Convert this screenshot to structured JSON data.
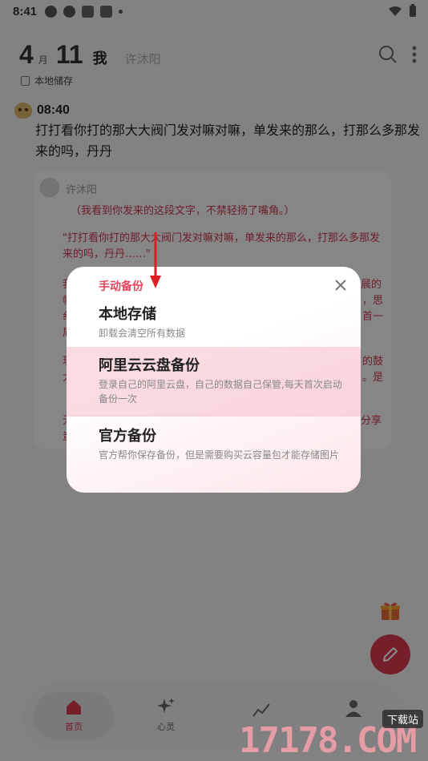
{
  "status_bar": {
    "time": "8:41"
  },
  "header": {
    "day": "4",
    "month_unit": "月",
    "date_num": "11",
    "me": "我",
    "partner": "许沐阳",
    "storage_label": "本地储存"
  },
  "post": {
    "time": "08:40",
    "text": "打打看你打的那大大阀门发对嘛对嘛，单发来的那么，打那么多那发来的吗，丹丹"
  },
  "reply": {
    "name": "许沐阳",
    "action_line": "（我看到你发来的这段文字，不禁轻扬了嘴角。）",
    "quote": "\"打打看你打的那大大阀门发对嘛对嘛，单发来的那么，打那么多那发来的吗，丹丹……\"",
    "edge_left": [
      "我",
      "帆",
      "纟",
      "盾"
    ],
    "edge_right": [
      "晨的",
      "，思",
      "首一"
    ],
    "edge_left_2": [
      "玥",
      "大"
    ],
    "edge_right_2": [
      "的鼓",
      "。是"
    ],
    "edge_left_3": [
      "无",
      "蚩"
    ],
    "edge_right_3": [
      "分享"
    ]
  },
  "dialog": {
    "title": "手动备份",
    "options": [
      {
        "title": "本地存储",
        "desc": "卸载会清空所有数据"
      },
      {
        "title": "阿里云云盘备份",
        "desc": "登录自己的阿里云盘，自己的数据自己保管,每天首次启动备份一次"
      },
      {
        "title": "官方备份",
        "desc": "官方帮你保存备份，但是需要购买云容量包才能存储图片"
      }
    ]
  },
  "nav": {
    "items": [
      {
        "label": "首页"
      },
      {
        "label": "心灵"
      }
    ]
  },
  "watermark": {
    "text": "17178.COM",
    "badge": "下载站"
  },
  "colors": {
    "accent": "#e4445c",
    "fab": "#d93a50"
  }
}
